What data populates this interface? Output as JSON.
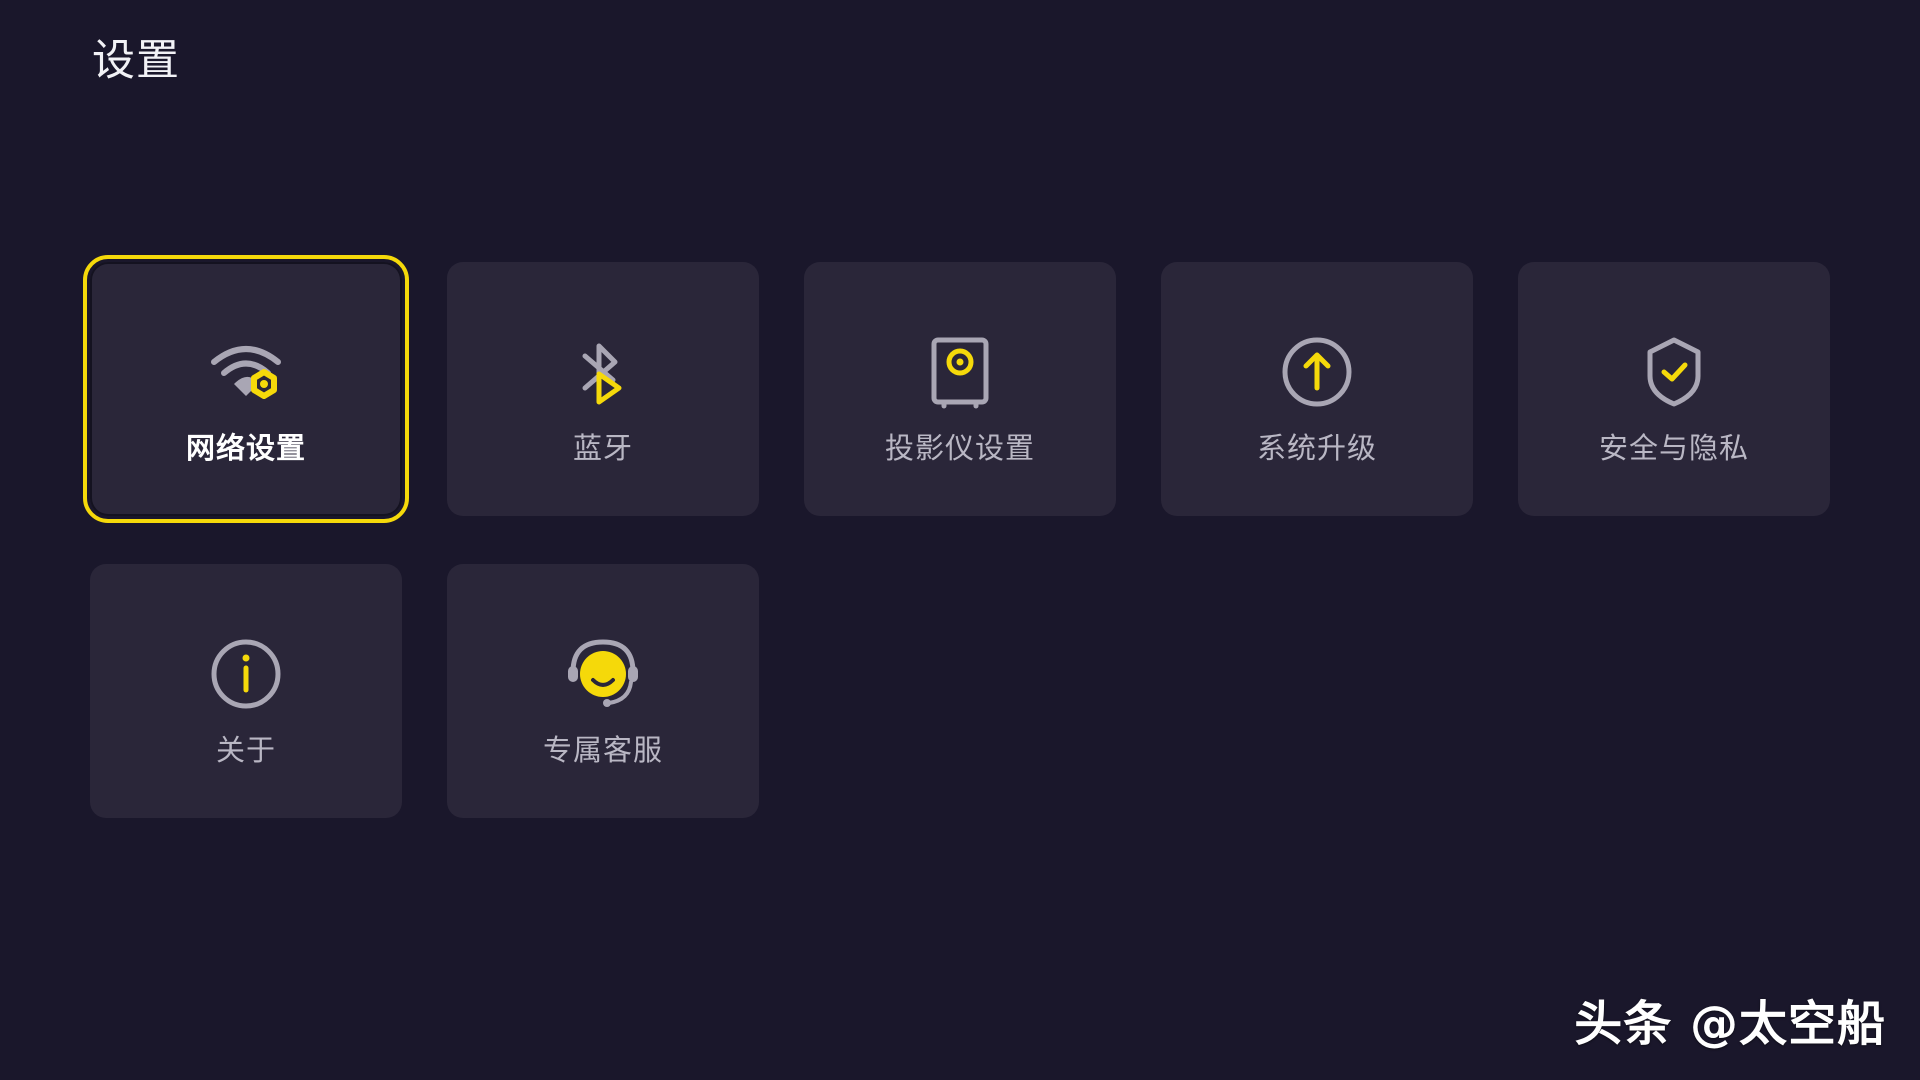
{
  "page": {
    "title": "设置"
  },
  "theme": {
    "background": "#1a172b",
    "tile_background": "#2a2639",
    "accent": "#f5d90a",
    "icon_gray": "#a9a6b4",
    "label_gray": "#b9b7c4"
  },
  "tiles": [
    {
      "label": "网络设置",
      "icon": "wifi-gear-icon",
      "focused": true
    },
    {
      "label": "蓝牙",
      "icon": "bluetooth-icon",
      "focused": false
    },
    {
      "label": "投影仪设置",
      "icon": "projector-icon",
      "focused": false
    },
    {
      "label": "系统升级",
      "icon": "upgrade-arrow-icon",
      "focused": false
    },
    {
      "label": "安全与隐私",
      "icon": "shield-check-icon",
      "focused": false
    },
    {
      "label": "关于",
      "icon": "info-icon",
      "focused": false
    },
    {
      "label": "专属客服",
      "icon": "headset-smile-icon",
      "focused": false
    }
  ],
  "watermark": {
    "text": "头条 @太空船"
  }
}
